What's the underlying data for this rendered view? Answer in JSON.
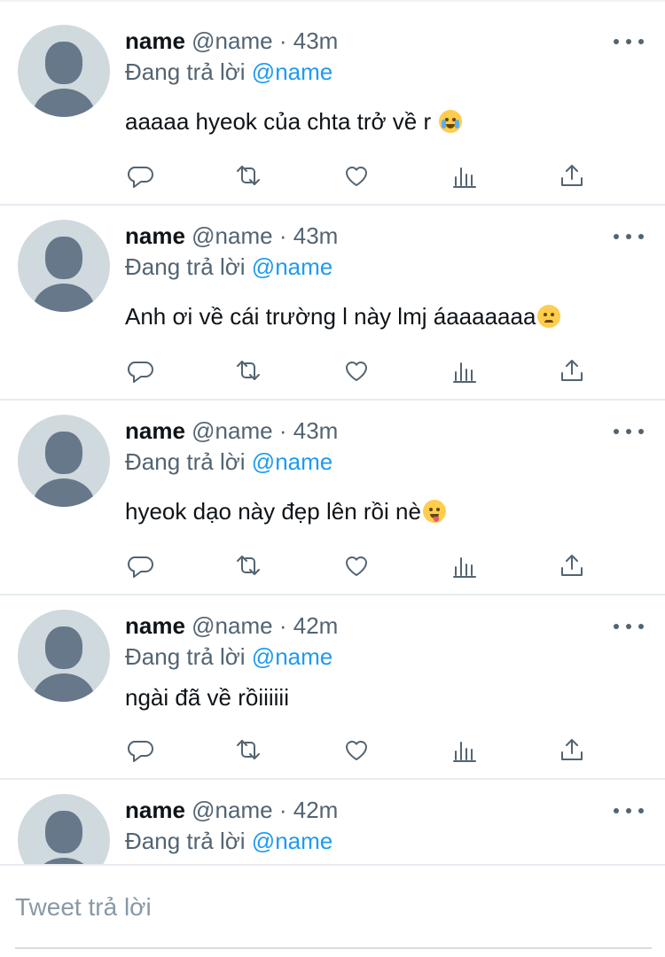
{
  "tweets": [
    {
      "name": "name",
      "handle": "@name",
      "dot": "·",
      "time": "43m",
      "reply_prefix": "Đang trả lời",
      "reply_handle": "@name",
      "text": "aaaaa hyeok của chta trở về r",
      "emoji": "loudly-crying-face"
    },
    {
      "name": "name",
      "handle": "@name",
      "dot": "·",
      "time": "43m",
      "reply_prefix": "Đang trả lời",
      "reply_handle": "@name",
      "text": "Anh ơi về cái trường l này lmj áaaaaaaa",
      "emoji": "disappointed-face"
    },
    {
      "name": "name",
      "handle": "@name",
      "dot": "·",
      "time": "43m",
      "reply_prefix": "Đang trả lời",
      "reply_handle": "@name",
      "text": "hyeok dạo này đẹp lên rồi nè",
      "emoji": "face-savoring-food"
    },
    {
      "name": "name",
      "handle": "@name",
      "dot": "·",
      "time": "42m",
      "reply_prefix": "Đang trả lời",
      "reply_handle": "@name",
      "text": "ngài đã về rồiiiiii",
      "emoji": ""
    },
    {
      "name": "name",
      "handle": "@name",
      "dot": "·",
      "time": "42m",
      "reply_prefix": "Đang trả lời",
      "reply_handle": "@name",
      "text": "",
      "emoji": ""
    }
  ],
  "icons": {
    "more": "more-horizontal-icon",
    "reply": "reply-bubble-icon",
    "retweet": "retweet-icon",
    "like": "heart-icon",
    "views": "analytics-bars-icon",
    "share": "share-upload-icon"
  },
  "colors": {
    "link_blue": "#1d9bf0",
    "secondary_text": "#536471",
    "avatar_bg": "#cfd9de",
    "avatar_fg": "#66788a",
    "divider": "#e6ecf0"
  },
  "composer": {
    "placeholder": "Tweet trả lời"
  }
}
